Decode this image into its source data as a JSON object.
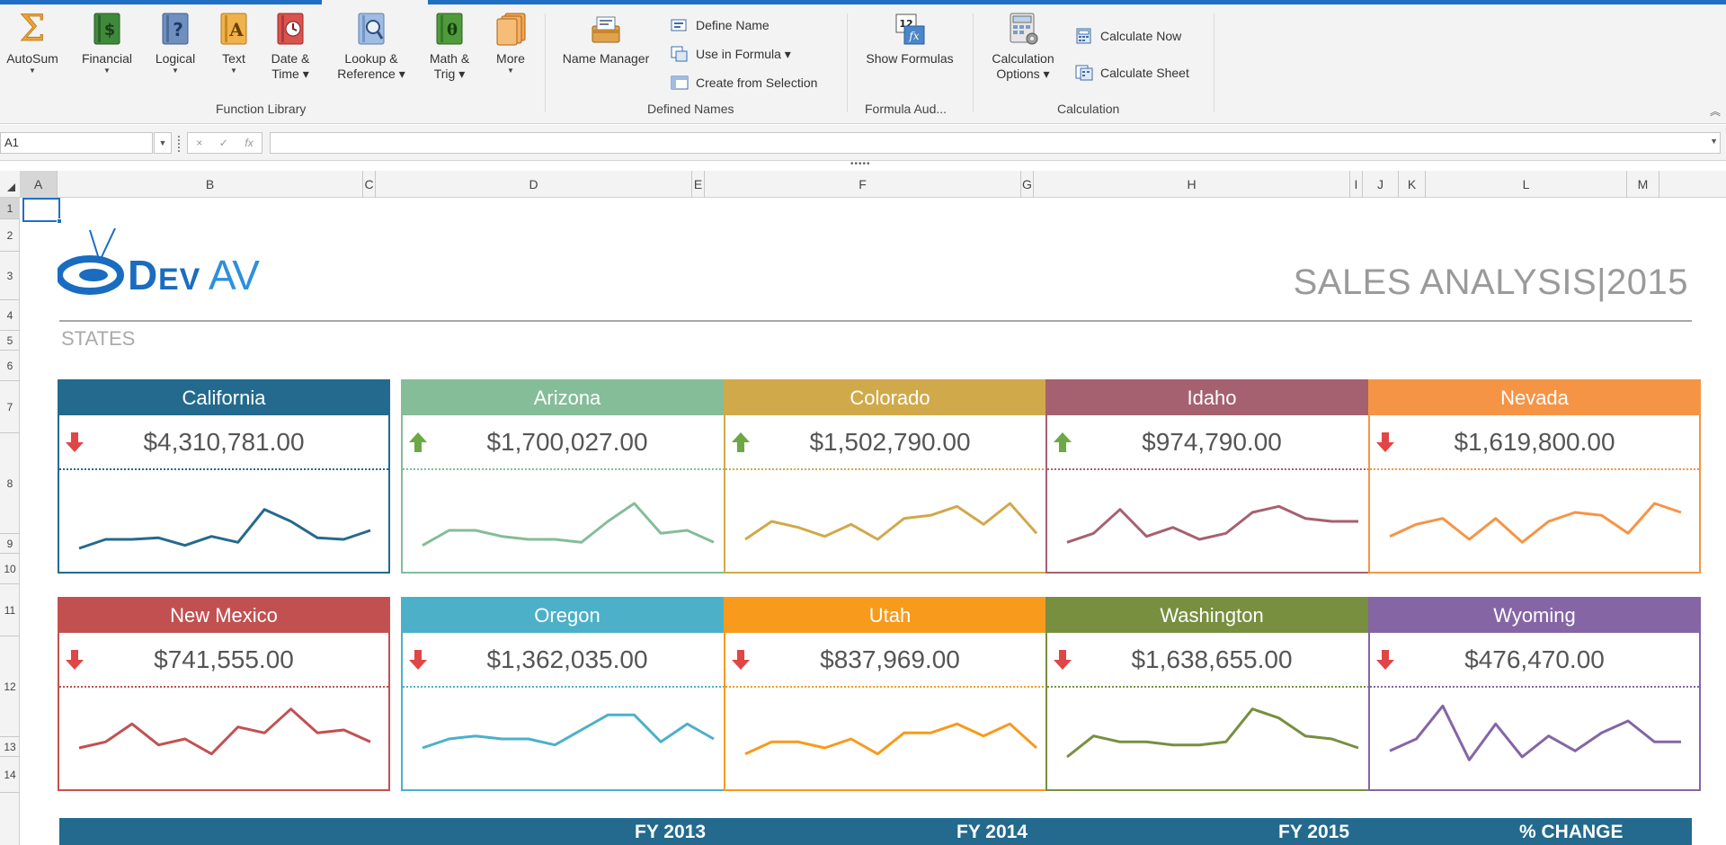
{
  "ribbon": {
    "groups": [
      {
        "label": "Function Library"
      },
      {
        "label": "Defined Names"
      },
      {
        "label": "Formula Aud..."
      },
      {
        "label": "Calculation"
      }
    ],
    "function_library": [
      {
        "label": "AutoSum",
        "label2": "",
        "icon": "autosum-icon"
      },
      {
        "label": "Financial",
        "label2": "",
        "icon": "financial-icon"
      },
      {
        "label": "Logical",
        "label2": "",
        "icon": "logical-icon"
      },
      {
        "label": "Text",
        "label2": "",
        "icon": "text-function-icon"
      },
      {
        "label": "Date &",
        "label2": "Time ▾",
        "icon": "date-time-icon"
      },
      {
        "label": "Lookup &",
        "label2": "Reference ▾",
        "icon": "lookup-reference-icon"
      },
      {
        "label": "Math &",
        "label2": "Trig ▾",
        "icon": "math-trig-icon"
      },
      {
        "label": "More",
        "label2": "",
        "icon": "more-functions-icon"
      }
    ],
    "defined_names": {
      "name_manager": "Name Manager",
      "define_name": "Define Name",
      "use_in_formula": "Use in Formula ▾",
      "create_from_selection": "Create from Selection"
    },
    "formula_auditing": {
      "show_formulas": "Show Formulas"
    },
    "calculation": {
      "options_line1": "Calculation",
      "options_line2": "Options ▾",
      "calculate_now": "Calculate Now",
      "calculate_sheet": "Calculate Sheet"
    },
    "collapse_glyph": "︽"
  },
  "formula_bar": {
    "name_box": "A1",
    "formula": "",
    "cancel": "×",
    "enter": "✓",
    "fx": "fx"
  },
  "columns": [
    "A",
    "B",
    "C",
    "D",
    "E",
    "F",
    "G",
    "H",
    "I",
    "J",
    "K",
    "L",
    "M"
  ],
  "rows": [
    "1",
    "2",
    "3",
    "4",
    "5",
    "6",
    "7",
    "8",
    "9",
    "10",
    "11",
    "12",
    "13",
    "14"
  ],
  "sheet": {
    "title": "SALES ANALYSIS|2015",
    "section_label": "STATES",
    "logo_text": "DEVAV",
    "cards": [
      {
        "state": "California",
        "value": "$4,310,781.00",
        "trend": "down",
        "color": "#246a8e",
        "spark": [
          3,
          6,
          6,
          6.5,
          4,
          7,
          5,
          16,
          12,
          6.5,
          6,
          9
        ]
      },
      {
        "state": "Arizona",
        "value": "$1,700,027.00",
        "trend": "up",
        "color": "#84bd98",
        "spark": [
          4,
          9,
          9,
          7,
          6,
          6,
          5,
          12,
          18,
          8,
          9,
          5
        ]
      },
      {
        "state": "Colorado",
        "value": "$1,502,790.00",
        "trend": "up",
        "color": "#d0a94a",
        "spark": [
          6,
          12,
          10,
          7,
          11,
          6,
          13,
          14,
          17,
          11,
          18,
          8
        ]
      },
      {
        "state": "Idaho",
        "value": "$974,790.00",
        "trend": "up",
        "color": "#a5616f",
        "spark": [
          5,
          8,
          16,
          7,
          10,
          6,
          8,
          15,
          17,
          13,
          12,
          12
        ]
      },
      {
        "state": "Nevada",
        "value": "$1,619,800.00",
        "trend": "down",
        "color": "#f69446",
        "spark": [
          7,
          11,
          13,
          6,
          13,
          5,
          12,
          15,
          14,
          8,
          18,
          15
        ]
      },
      {
        "state": "New Mexico",
        "value": "$741,555.00",
        "trend": "down",
        "color": "#c35051",
        "spark": [
          9,
          11,
          17,
          10,
          12,
          7,
          16,
          14,
          22,
          14,
          15,
          11
        ]
      },
      {
        "state": "Oregon",
        "value": "$1,362,035.00",
        "trend": "down",
        "color": "#4cb0c9",
        "spark": [
          9,
          12,
          13,
          12,
          12,
          10,
          15,
          20,
          20,
          11,
          17,
          12
        ]
      },
      {
        "state": "Utah",
        "value": "$837,969.00",
        "trend": "down",
        "color": "#f89a1c",
        "spark": [
          7,
          11,
          11,
          9,
          12,
          7,
          14,
          14,
          17,
          13,
          17,
          9
        ]
      },
      {
        "state": "Washington",
        "value": "$1,638,655.00",
        "trend": "down",
        "color": "#778f3f",
        "spark": [
          6,
          13,
          11,
          11,
          10,
          10,
          11,
          22,
          19,
          13,
          12,
          9
        ]
      },
      {
        "state": "Wyoming",
        "value": "$476,470.00",
        "trend": "down",
        "color": "#8565a4",
        "spark": [
          8,
          12,
          23,
          5,
          17,
          6,
          13,
          8,
          14,
          18,
          11,
          11
        ]
      }
    ],
    "table_header": [
      "FY 2013",
      "FY 2014",
      "FY 2015",
      "% CHANGE"
    ],
    "trend_colors": {
      "up": "#6ca844",
      "down": "#e04646"
    }
  }
}
